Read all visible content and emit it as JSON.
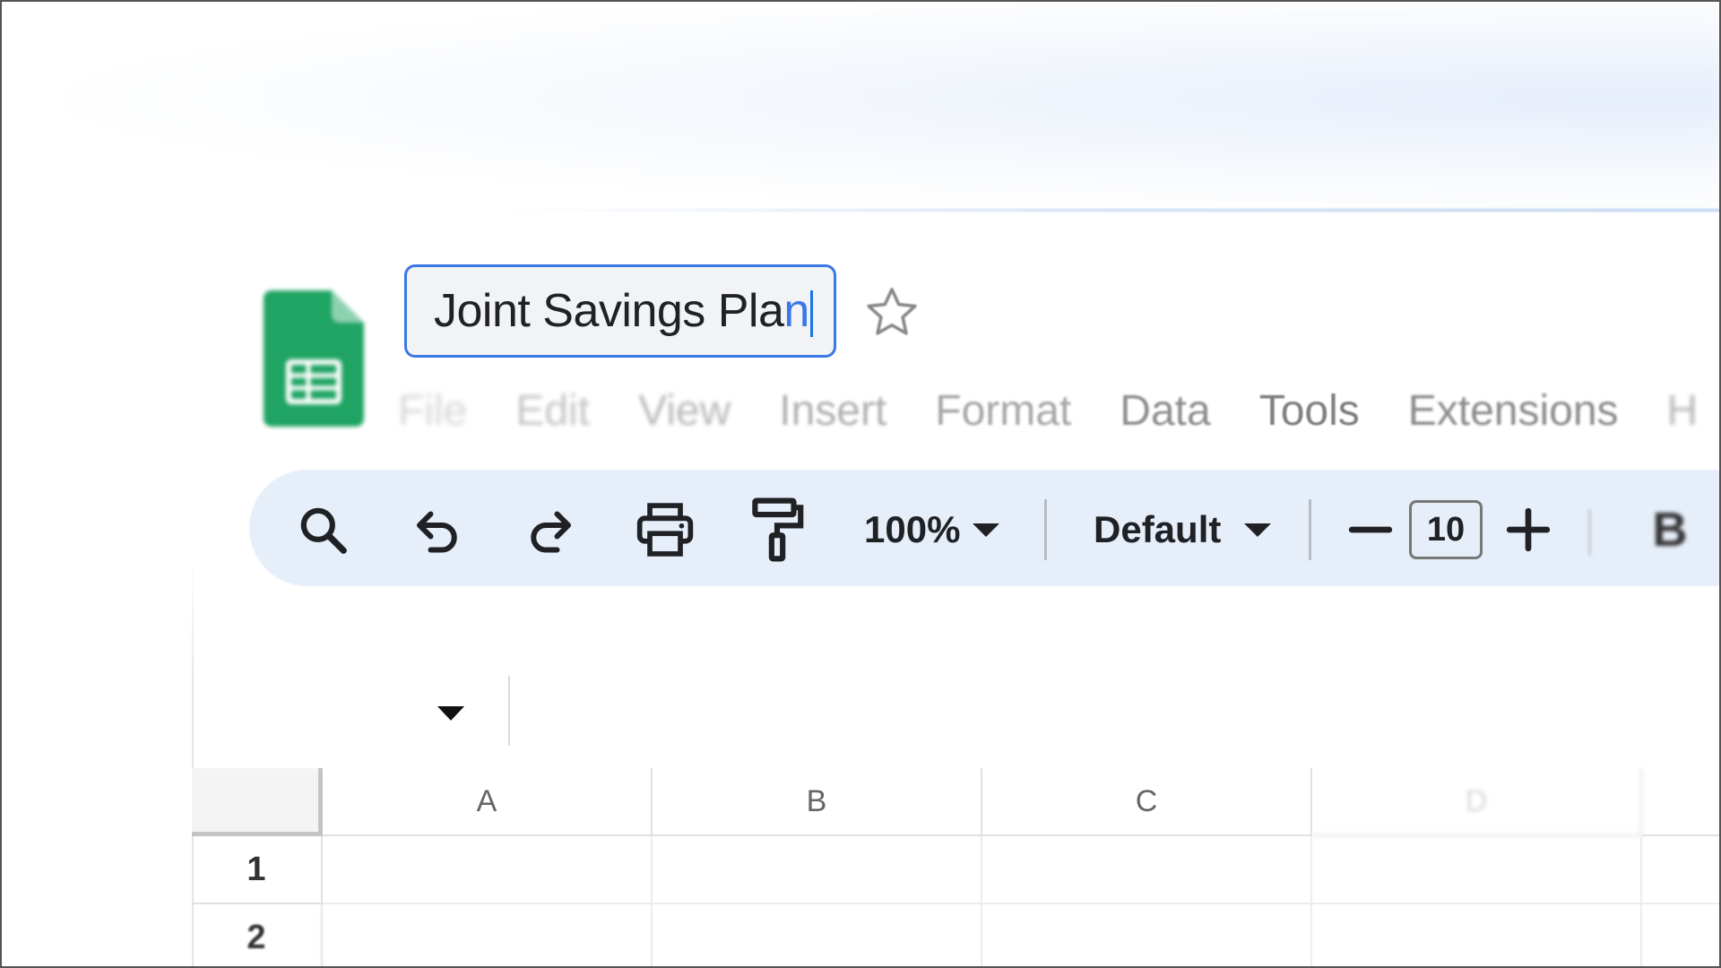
{
  "document": {
    "title": "Joint Savings Pla",
    "title_last_char": "n"
  },
  "menu": {
    "file": "File",
    "edit": "Edit",
    "view": "View",
    "insert": "Insert",
    "format": "Format",
    "data": "Data",
    "tools": "Tools",
    "extensions": "Extensions",
    "help": "H"
  },
  "toolbar": {
    "zoom": "100%",
    "font": "Default",
    "font_size": "10",
    "bold_label": "B",
    "icons": [
      "search-icon",
      "undo-icon",
      "redo-icon",
      "print-icon",
      "paint-format-icon",
      "chevron-down-icon",
      "minus-icon",
      "plus-icon"
    ]
  },
  "grid": {
    "columns": [
      "A",
      "B",
      "C",
      "D"
    ],
    "rows": [
      "1",
      "2"
    ]
  },
  "colors": {
    "accent": "#1a73e8",
    "toolbar_bg": "#e6eefa",
    "sheets_green": "#1fa463"
  }
}
